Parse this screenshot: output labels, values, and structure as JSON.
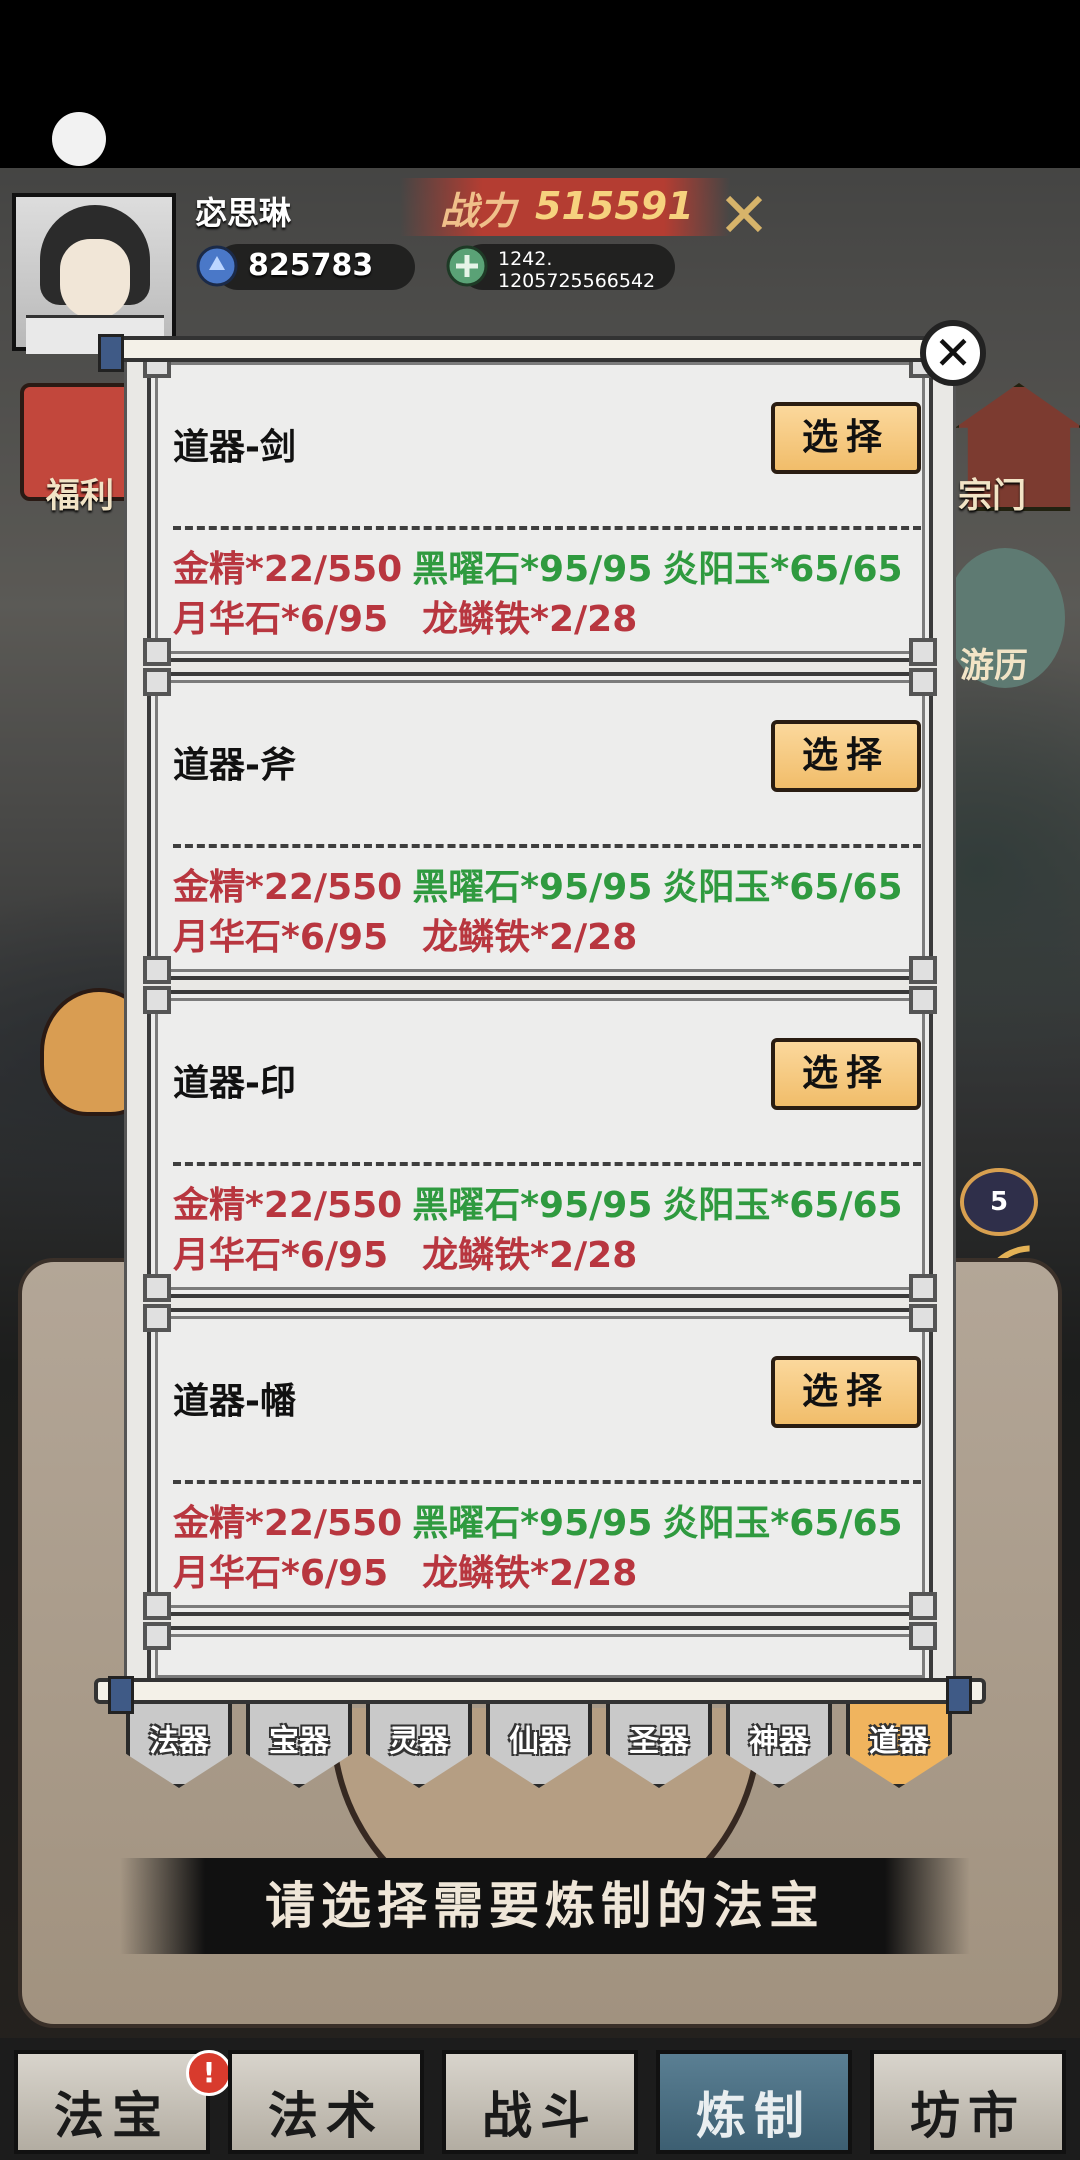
{
  "player": {
    "name": "宓思琳",
    "power_label": "战力",
    "power_value": "515591",
    "currency1": "825783",
    "currency2_line1": "1242.",
    "currency2_line2": "1205725566542"
  },
  "side": {
    "gift_label": "福利",
    "temple_label": "宗门",
    "round_label": "游历",
    "badge_count": "5"
  },
  "dialog": {
    "close_symbol": "✕",
    "items": [
      {
        "title": "道器-剑",
        "select": "选择",
        "materials": [
          {
            "text": "金精*22/550",
            "ok": false
          },
          {
            "text": "黑曜石*95/95",
            "ok": true
          },
          {
            "text": "炎阳玉*65/65",
            "ok": true
          },
          {
            "text": "月华石*6/95",
            "ok": false
          },
          {
            "text": "龙鳞铁*2/28",
            "ok": false
          }
        ]
      },
      {
        "title": "道器-斧",
        "select": "选择",
        "materials": [
          {
            "text": "金精*22/550",
            "ok": false
          },
          {
            "text": "黑曜石*95/95",
            "ok": true
          },
          {
            "text": "炎阳玉*65/65",
            "ok": true
          },
          {
            "text": "月华石*6/95",
            "ok": false
          },
          {
            "text": "龙鳞铁*2/28",
            "ok": false
          }
        ]
      },
      {
        "title": "道器-印",
        "select": "选择",
        "materials": [
          {
            "text": "金精*22/550",
            "ok": false
          },
          {
            "text": "黑曜石*95/95",
            "ok": true
          },
          {
            "text": "炎阳玉*65/65",
            "ok": true
          },
          {
            "text": "月华石*6/95",
            "ok": false
          },
          {
            "text": "龙鳞铁*2/28",
            "ok": false
          }
        ]
      },
      {
        "title": "道器-幡",
        "select": "选择",
        "materials": [
          {
            "text": "金精*22/550",
            "ok": false
          },
          {
            "text": "黑曜石*95/95",
            "ok": true
          },
          {
            "text": "炎阳玉*65/65",
            "ok": true
          },
          {
            "text": "月华石*6/95",
            "ok": false
          },
          {
            "text": "龙鳞铁*2/28",
            "ok": false
          }
        ]
      }
    ]
  },
  "tabs": [
    {
      "label": "法器",
      "active": false
    },
    {
      "label": "宝器",
      "active": false
    },
    {
      "label": "灵器",
      "active": false
    },
    {
      "label": "仙器",
      "active": false
    },
    {
      "label": "圣器",
      "active": false
    },
    {
      "label": "神器",
      "active": false
    },
    {
      "label": "道器",
      "active": true
    }
  ],
  "prompt": "请选择需要炼制的法宝",
  "nav": {
    "items": [
      {
        "label": "法宝",
        "active": false
      },
      {
        "label": "法术",
        "active": false
      },
      {
        "label": "战斗",
        "active": false
      },
      {
        "label": "炼制",
        "active": true
      },
      {
        "label": "坊市",
        "active": false
      }
    ],
    "alert": "!"
  },
  "colors": {
    "material_ok": "#2f9a3f",
    "material_missing": "#b8363f",
    "tab_active": "#f0b45e",
    "nav_active": "#4a6f82"
  }
}
